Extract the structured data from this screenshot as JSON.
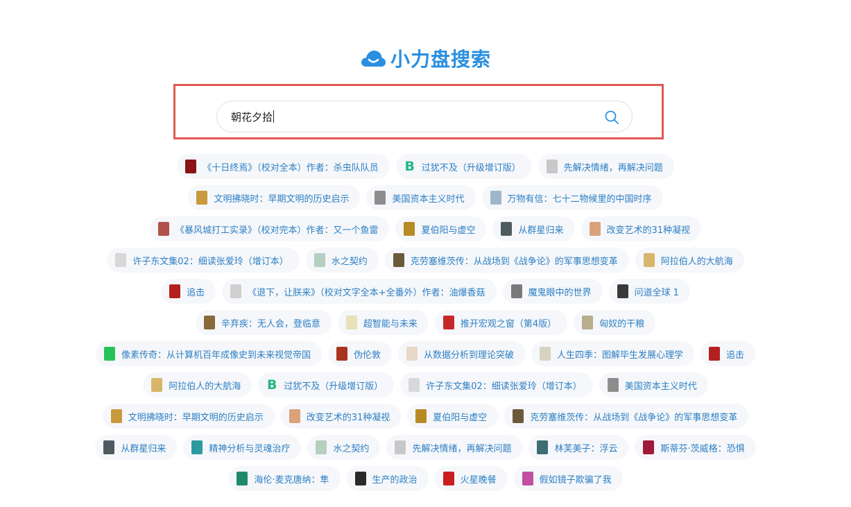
{
  "logo": {
    "text": "小力盘搜索",
    "color": "#2a8fe0"
  },
  "search": {
    "value": "朝花夕拾",
    "placeholder": "",
    "button_icon": "search-icon",
    "highlight_color": "#e05a52"
  },
  "rows": [
    [
      {
        "label": "《十日终焉》（校对全本）作者：杀虫队队员",
        "thumb": "#8a1414"
      },
      {
        "label": "过犹不及（升级增订版）",
        "thumb": "letter-B"
      },
      {
        "label": "先解决情绪，再解决问题",
        "thumb": "#c8c8c8"
      }
    ],
    [
      {
        "label": "文明拂晓时：早期文明的历史启示",
        "thumb": "#c99a3d"
      },
      {
        "label": "美国资本主义时代",
        "thumb": "#8d8d8d"
      },
      {
        "label": "万物有信：七十二物候里的中国时序",
        "thumb": "#9fb6c8"
      }
    ],
    [
      {
        "label": "《暴风城打工实录》（校对完本）作者：又一个鱼雷",
        "thumb": "#b0504a"
      },
      {
        "label": "夏伯阳与虚空",
        "thumb": "#b78a26"
      },
      {
        "label": "从群星归来",
        "thumb": "#4f5b5e"
      },
      {
        "label": "改变艺术的31种凝视",
        "thumb": "#d9a27a"
      }
    ],
    [
      {
        "label": "许子东文集02：细读张爱玲（增订本）",
        "thumb": "#d8d8d8"
      },
      {
        "label": "水之契约",
        "thumb": "#b5cfc0"
      },
      {
        "label": "克劳塞维茨传：从战场到《战争论》的军事思想变革",
        "thumb": "#6b5a3a"
      },
      {
        "label": "阿拉伯人的大航海",
        "thumb": "#d9b56a"
      }
    ],
    [
      {
        "label": "追击",
        "thumb": "#b42020"
      },
      {
        "label": "《退下，让朕来》（校对文字全本+全番外）作者：油爆香菇",
        "thumb": "#cfcfcf"
      },
      {
        "label": "魔鬼眼中的世界",
        "thumb": "#7a7a7a"
      },
      {
        "label": "问道全球 1",
        "thumb": "#3a3a3a"
      }
    ],
    [
      {
        "label": "辛弃疾：无人会，登临意",
        "thumb": "#8a6a3a"
      },
      {
        "label": "超智能与未来",
        "thumb": "#e7e2b8"
      },
      {
        "label": "推开宏观之窗（第4版）",
        "thumb": "#c52a2a"
      },
      {
        "label": "匈奴的干粮",
        "thumb": "#b8ad8c"
      }
    ],
    [
      {
        "label": "像素传奇：从计算机百年成像史到未来视觉帝国",
        "thumb": "#27c35a"
      },
      {
        "label": "伪伦敦",
        "thumb": "#a8331f"
      },
      {
        "label": "从数据分析到理论突破",
        "thumb": "#e8d8c8"
      },
      {
        "label": "人生四季：图解毕生发展心理学",
        "thumb": "#d8d2c0"
      },
      {
        "label": "追击",
        "thumb": "#b42020"
      }
    ],
    [
      {
        "label": "阿拉伯人的大航海",
        "thumb": "#d9b56a"
      },
      {
        "label": "过犹不及（升级增订版）",
        "thumb": "letter-B"
      },
      {
        "label": "许子东文集02：细读张爱玲（增订本）",
        "thumb": "#d8d8d8"
      },
      {
        "label": "美国资本主义时代",
        "thumb": "#8d8d8d"
      }
    ],
    [
      {
        "label": "文明拂晓时：早期文明的历史启示",
        "thumb": "#c99a3d"
      },
      {
        "label": "改变艺术的31种凝视",
        "thumb": "#d9a27a"
      },
      {
        "label": "夏伯阳与虚空",
        "thumb": "#b78a26"
      },
      {
        "label": "克劳塞维茨传：从战场到《战争论》的军事思想变革",
        "thumb": "#6b5a3a"
      }
    ],
    [
      {
        "label": "从群星归来",
        "thumb": "#4f5b5e"
      },
      {
        "label": "精神分析与灵魂治疗",
        "thumb": "#2c9aa0"
      },
      {
        "label": "水之契约",
        "thumb": "#b5cfc0"
      },
      {
        "label": "先解决情绪，再解决问题",
        "thumb": "#c8c8c8"
      },
      {
        "label": "林芙美子：浮云",
        "thumb": "#3c6e74"
      },
      {
        "label": "斯蒂芬·茨威格：恐惧",
        "thumb": "#a01a3a"
      }
    ],
    [
      {
        "label": "海伦·麦克唐纳：隼",
        "thumb": "#1f8a6a"
      },
      {
        "label": "生产的政治",
        "thumb": "#2a2a2a"
      },
      {
        "label": "火星晚餐",
        "thumb": "#c81e1e"
      },
      {
        "label": "假如镜子欺骗了我",
        "thumb": "#c24fa0"
      }
    ]
  ]
}
